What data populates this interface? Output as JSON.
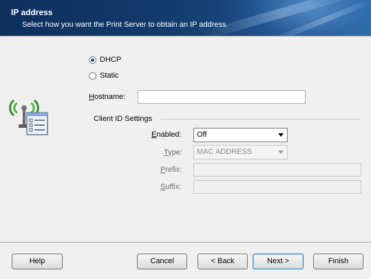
{
  "header": {
    "title": "IP address",
    "subtitle": "Select how you want the Print Server to obtain an IP address."
  },
  "ip_mode": {
    "options": [
      {
        "label": "DHCP",
        "selected": true
      },
      {
        "label": "Static",
        "selected": false
      }
    ]
  },
  "hostname": {
    "label_prefix": "H",
    "label_rest": "ostname:",
    "value": ""
  },
  "client_id": {
    "group_label": "Client ID Settings",
    "enabled": {
      "label_prefix": "E",
      "label_rest": "nabled:",
      "value": "Off"
    },
    "type": {
      "label_prefix": "T",
      "label_rest": "ype:",
      "value": "MAC ADDRESS"
    },
    "prefix": {
      "label_prefix": "P",
      "label_rest": "refix:",
      "value": ""
    },
    "suffix": {
      "label_prefix": "S",
      "label_rest": "uffix:",
      "value": ""
    }
  },
  "buttons": {
    "help": "Help",
    "cancel": "Cancel",
    "back": "< Back",
    "next": "Next >",
    "finish": "Finish"
  },
  "icons": {
    "network": "wireless-network-settings-icon"
  }
}
